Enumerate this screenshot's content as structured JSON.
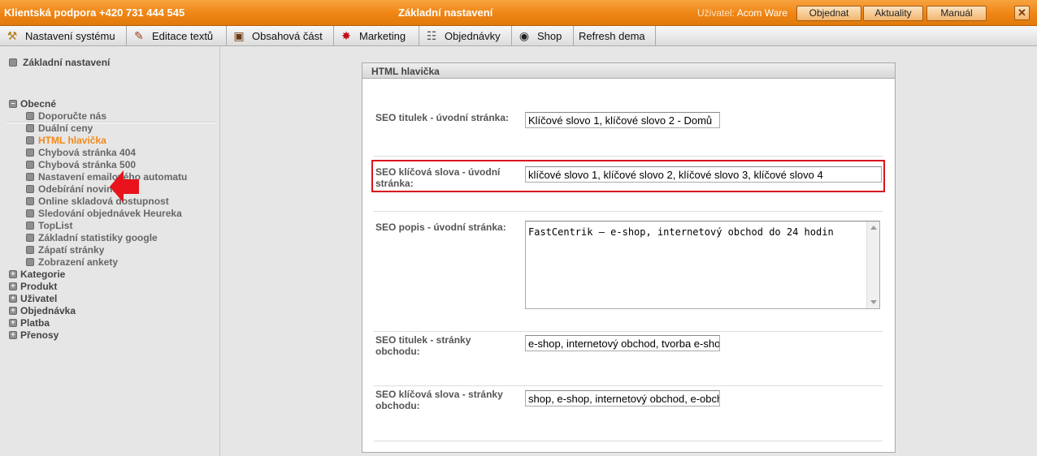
{
  "topbar": {
    "support": "Klientská podpora +420 731 444 545",
    "title": "Základní nastavení",
    "user_label": "Uživatel:",
    "user_name": "Acom Ware",
    "buttons": [
      "Objednat",
      "Aktuality",
      "Manuál"
    ],
    "close": "✕"
  },
  "menu": [
    {
      "label": "Nastavení systému",
      "icon": "tools-icon"
    },
    {
      "label": "Editace textů",
      "icon": "edit-text-icon"
    },
    {
      "label": "Obsahová část",
      "icon": "content-icon"
    },
    {
      "label": "Marketing",
      "icon": "star-icon"
    },
    {
      "label": "Objednávky",
      "icon": "orders-icon"
    },
    {
      "label": "Shop",
      "icon": "eye-icon"
    },
    {
      "label": "Refresh dema",
      "icon": ""
    }
  ],
  "sidebar": {
    "top_item": "Základní nastavení",
    "groups": {
      "obecne": "Obecné",
      "obecne_items": [
        "Doporučte nás",
        "Duální ceny",
        "HTML hlavička",
        "Chybová stránka 404",
        "Chybová stránka 500",
        "Nastavení emailového automatu",
        "Odebírání novinek",
        "Online skladová dostupnost",
        "Sledování objednávek Heureka",
        "TopList",
        "Základní statistiky google",
        "Zápatí stránky",
        "Zobrazení ankety"
      ],
      "others": [
        "Kategorie",
        "Produkt",
        "Uživatel",
        "Objednávka",
        "Platba",
        "Přenosy"
      ]
    },
    "active_item": "HTML hlavička",
    "active_color": "#f28a1a"
  },
  "panel": {
    "title": "HTML hlavička",
    "fields": [
      {
        "label": "SEO titulek - úvodní stránka:",
        "value": "Klíčové slovo 1, klíčové slovo 2 - Domů"
      },
      {
        "label": "SEO klíčová slova - úvodní stránka:",
        "value": "klíčové slovo 1, klíčové slovo 2, klíčové slovo 3, klíčové slovo 4"
      },
      {
        "label": "SEO popis - úvodní stránka:",
        "value": "FastCentrik – e-shop, internetový obchod do 24 hodin"
      },
      {
        "label": "SEO titulek - stránky obchodu:",
        "value": "e-shop, internetový obchod, tvorba e-shopu"
      },
      {
        "label": "SEO klíčová slova - stránky obchodu:",
        "value": "shop, e-shop, internetový obchod, e-obchod"
      }
    ]
  },
  "colors": {
    "accent": "#ef8514",
    "highlight": "#d9141e"
  }
}
